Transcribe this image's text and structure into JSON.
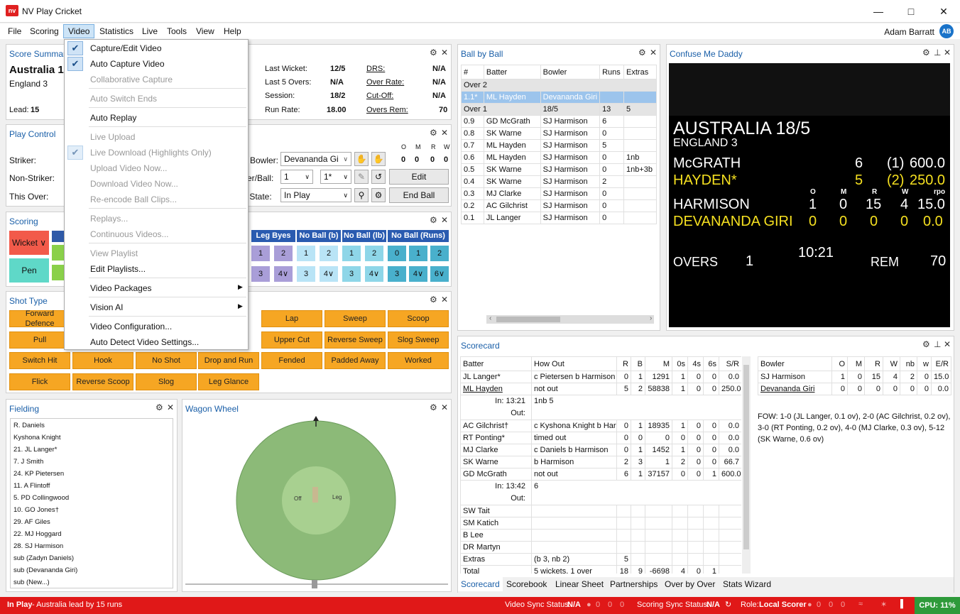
{
  "app": {
    "title": "NV Play Cricket",
    "logo": "nv",
    "user": "Adam Barratt",
    "initials": "AB"
  },
  "menubar": [
    "File",
    "Scoring",
    "Video",
    "Statistics",
    "Live",
    "Tools",
    "View",
    "Help"
  ],
  "video_menu": {
    "capture": "Capture/Edit Video",
    "auto_capture": "Auto Capture Video",
    "collab": "Collaborative Capture",
    "auto_switch": "Auto Switch Ends",
    "auto_replay": "Auto Replay",
    "live_upload": "Live Upload",
    "live_download": "Live Download (Highlights Only)",
    "upload_now": "Upload Video Now...",
    "download_now": "Download Video Now...",
    "reencode": "Re-encode Ball Clips...",
    "replays": "Replays...",
    "continuous": "Continuous Videos...",
    "view_playlist": "View Playlist",
    "edit_playlists": "Edit Playlists...",
    "packages": "Video Packages",
    "vision": "Vision AI",
    "config": "Video Configuration...",
    "autodetect": "Auto Detect Video Settings..."
  },
  "score_summary": {
    "title": "Score Summary",
    "team1": "Australia 1",
    "team2": "England 3",
    "lead_label": "Lead:",
    "lead": "15",
    "last_wicket_l": "Last Wicket:",
    "last_wicket": "12/5",
    "last5_l": "Last 5 Overs:",
    "last5": "N/A",
    "session_l": "Session:",
    "session": "18/2",
    "rr_l": "Run Rate:",
    "rr": "18.00",
    "drs_l": "DRS:",
    "drs": "N/A",
    "or_l": "Over Rate:",
    "or": "N/A",
    "cutoff_l": "Cut-Off:",
    "cutoff": "N/A",
    "oversrem_l": "Overs Rem:",
    "oversrem": "70"
  },
  "play_control": {
    "title": "Play Control",
    "striker": "Striker:",
    "nonstriker": "Non-Striker:",
    "thisover": "This Over:",
    "bowler_l": "Bowler:",
    "bowler": "Devananda Gi",
    "overball_l": "ver/Ball:",
    "over": "1",
    "ball": "1*",
    "state_l": "y State:",
    "state": "In Play",
    "edit": "Edit",
    "endball": "End Ball",
    "o": "O",
    "m": "M",
    "r": "R",
    "w": "W",
    "ov": "0",
    "mv": "0",
    "rv": "0",
    "wv": "0"
  },
  "scoring": {
    "title": "Scoring",
    "wicket": "Wicket",
    "pen": "Pen",
    "legbyes": "Leg Byes",
    "nb_b": "No Ball (b)",
    "nb_lb": "No Ball (lb)",
    "nb_runs": "No Ball (Runs)",
    "row1": [
      "1",
      "2",
      "1",
      "2",
      "1",
      "2",
      "0",
      "1",
      "2"
    ],
    "row2": [
      "3",
      "4",
      "3",
      "4",
      "3",
      "4",
      "3",
      "4",
      "6"
    ]
  },
  "shot_type": {
    "title": "Shot Type",
    "shots": [
      "Forward Defence",
      "Lap",
      "Sweep",
      "Scoop",
      "Pull",
      "Upper Cut",
      "Reverse Sweep",
      "Slog Sweep",
      "Switch Hit",
      "Hook",
      "No Shot",
      "Drop and Run",
      "Fended",
      "Padded Away",
      "Worked",
      "Flick",
      "Reverse Scoop",
      "Slog",
      "Leg Glance"
    ]
  },
  "fielding": {
    "title": "Fielding",
    "players": [
      "R. Daniels",
      "Kyshona Knight",
      "21. JL Langer*",
      "7. J Smith",
      "24. KP Pietersen",
      "11. A Flintoff",
      "5. PD Collingwood",
      "10. GO Jones†",
      "29. AF Giles",
      "22. MJ Hoggard",
      "28. SJ Harmison",
      "sub (Zadyn Daniels)",
      "sub (Devananda Giri)",
      "sub (New...)"
    ]
  },
  "wagon": {
    "title": "Wagon Wheel",
    "off": "Off",
    "leg": "Leg"
  },
  "bbb": {
    "title": "Ball by Ball",
    "headers": [
      "#",
      "Batter",
      "Bowler",
      "Runs",
      "Extras"
    ],
    "over2": "Over 2",
    "current": {
      "n": "1.1*",
      "bat": "ML Hayden",
      "bowl": "Devananda Giri",
      "runs": "",
      "extras": ""
    },
    "over1": {
      "label": "Over 1",
      "score": "18/5",
      "runs": "13",
      "extras": "5"
    },
    "rows": [
      [
        "0.9",
        "GD McGrath",
        "SJ Harmison",
        "6",
        ""
      ],
      [
        "0.8",
        "SK Warne",
        "SJ Harmison",
        "0",
        ""
      ],
      [
        "0.7",
        "ML Hayden",
        "SJ Harmison",
        "5",
        ""
      ],
      [
        "0.6",
        "ML Hayden",
        "SJ Harmison",
        "0",
        "1nb"
      ],
      [
        "0.5",
        "SK Warne",
        "SJ Harmison",
        "0",
        "1nb+3b"
      ],
      [
        "0.4",
        "SK Warne",
        "SJ Harmison",
        "2",
        ""
      ],
      [
        "0.3",
        "MJ Clarke",
        "SJ Harmison",
        "0",
        ""
      ],
      [
        "0.2",
        "AC Gilchrist",
        "SJ Harmison",
        "0",
        ""
      ],
      [
        "0.1",
        "JL Langer",
        "SJ Harmison",
        "0",
        ""
      ]
    ]
  },
  "cmd": {
    "title": "Confuse Me Daddy",
    "team": "AUSTRALIA 18/5",
    "opp": "ENGLAND  3",
    "b1": "McGRATH",
    "b1r": "6",
    "b1b": "(1)",
    "b1sr": "600.0",
    "b2": "HAYDEN*",
    "b2r": "5",
    "b2b": "(2)",
    "b2sr": "250.0",
    "ho": "O",
    "hm": "M",
    "hr": "R",
    "hw": "W",
    "hrpo": "rpo",
    "bw1": "HARMISON",
    "bw1v": [
      "1",
      "0",
      "15",
      "4",
      "15.0"
    ],
    "bw2": "DEVANANDA GIRI",
    "bw2v": [
      "0",
      "0",
      "0",
      "0",
      "0.0"
    ],
    "overs_l": "OVERS",
    "overs": "1",
    "time": "10:21",
    "rem_l": "REM",
    "rem": "70"
  },
  "scorecard": {
    "title": "Scorecard",
    "headers": [
      "Batter",
      "How Out",
      "R",
      "B",
      "M",
      "0s",
      "4s",
      "6s",
      "S/R"
    ],
    "rows": [
      [
        "JL Langer*",
        "c Pietersen b Harmison",
        "0",
        "1",
        "1291",
        "1",
        "0",
        "0",
        "0.0"
      ],
      [
        "ML Hayden",
        "not out",
        "5",
        "2",
        "58838",
        "1",
        "0",
        "0",
        "250.0"
      ]
    ],
    "in1": "In: 13:21",
    "in1v": "1nb 5",
    "out": "Out:",
    "rows2": [
      [
        "AC Gilchrist†",
        "c Kyshona Knight b Har",
        "0",
        "1",
        "18935",
        "1",
        "0",
        "0",
        "0.0"
      ],
      [
        "RT Ponting*",
        "timed out",
        "0",
        "0",
        "0",
        "0",
        "0",
        "0",
        "0.0"
      ],
      [
        "MJ Clarke",
        "c  Daniels b Harmison",
        "0",
        "1",
        "1452",
        "1",
        "0",
        "0",
        "0.0"
      ],
      [
        "SK Warne",
        "b Harmison",
        "2",
        "3",
        "1",
        "2",
        "0",
        "0",
        "66.7"
      ],
      [
        "GD McGrath",
        "not out",
        "6",
        "1",
        "37157",
        "0",
        "0",
        "1",
        "600.0"
      ]
    ],
    "in2": "In: 13:42",
    "in2v": "6",
    "dnb": [
      "SW Tait",
      "SM Katich",
      "B Lee",
      "DR Martyn"
    ],
    "extras_l": "Extras",
    "extras": "(b 3, nb 2)",
    "extras_r": "5",
    "total_l": "Total",
    "total": "5 wickets, 1 over",
    "total_vals": [
      "18",
      "9",
      "-6698",
      "4",
      "0",
      "1"
    ],
    "bowl_headers": [
      "Bowler",
      "O",
      "M",
      "R",
      "W",
      "nb",
      "w",
      "E/R"
    ],
    "bowl_rows": [
      [
        "SJ Harmison",
        "1",
        "0",
        "15",
        "4",
        "2",
        "0",
        "15.0"
      ],
      [
        "Devananda Giri",
        "0",
        "0",
        "0",
        "0",
        "0",
        "0",
        "0.0"
      ]
    ],
    "fow": "FOW: 1-0 (JL Langer, 0.1 ov), 2-0 (AC Gilchrist, 0.2 ov), 3-0 (RT Ponting, 0.2 ov), 4-0 (MJ Clarke, 0.3 ov), 5-12 (SK Warne, 0.6 ov)",
    "tabs": [
      "Scorecard",
      "Scorebook",
      "Linear Sheet",
      "Partnerships",
      "Over by Over",
      "Stats Wizard"
    ]
  },
  "status": {
    "left": "In Play",
    "left2": " - Australia lead by 15 runs",
    "vsync": "Video Sync Status:",
    "vsync_v": "N/A",
    "ssync": "Scoring Sync Status:",
    "ssync_v": "N/A",
    "role": "Role:",
    "role_v": "Local Scorer",
    "cpu": "CPU: 11%",
    "zeros": [
      "0",
      "0",
      "0"
    ]
  }
}
